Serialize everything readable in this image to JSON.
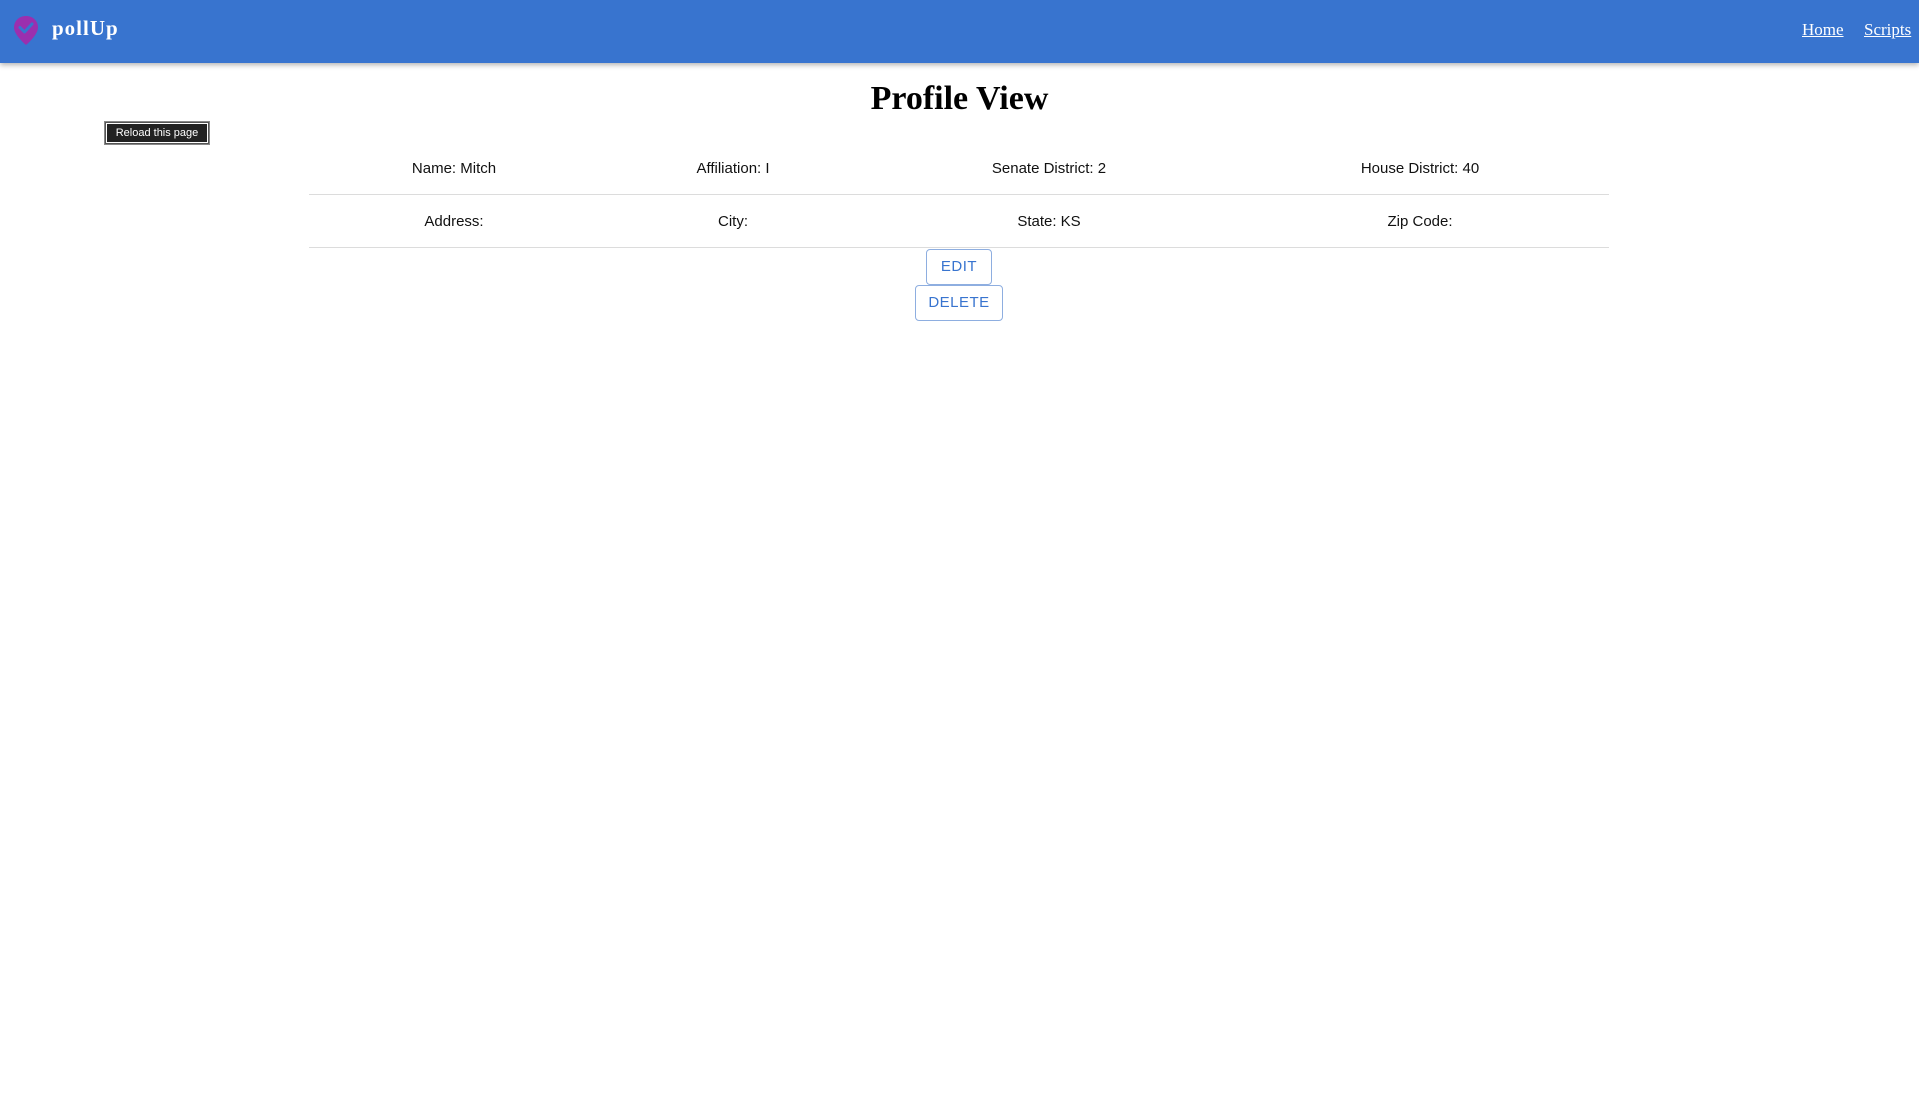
{
  "header": {
    "brand": "pollUp",
    "logo_icon": "location-check-pin-icon",
    "nav": [
      {
        "label": "Home"
      },
      {
        "label": "Scripts"
      }
    ],
    "colors": {
      "appbar": "#3874cf",
      "logo": "#9b2fae"
    }
  },
  "page": {
    "title": "Profile View",
    "reload_label": "Reload this page"
  },
  "profile": {
    "row1": [
      {
        "text": "Name: Mitch"
      },
      {
        "text": "Affiliation: I"
      },
      {
        "text": "Senate District: 2"
      },
      {
        "text": "House District: 40"
      }
    ],
    "row2": [
      {
        "text": "Address:"
      },
      {
        "text": "City:"
      },
      {
        "text": "State: KS"
      },
      {
        "text": "Zip Code:"
      }
    ]
  },
  "actions": {
    "edit_label": "EDIT",
    "delete_label": "DELETE"
  }
}
